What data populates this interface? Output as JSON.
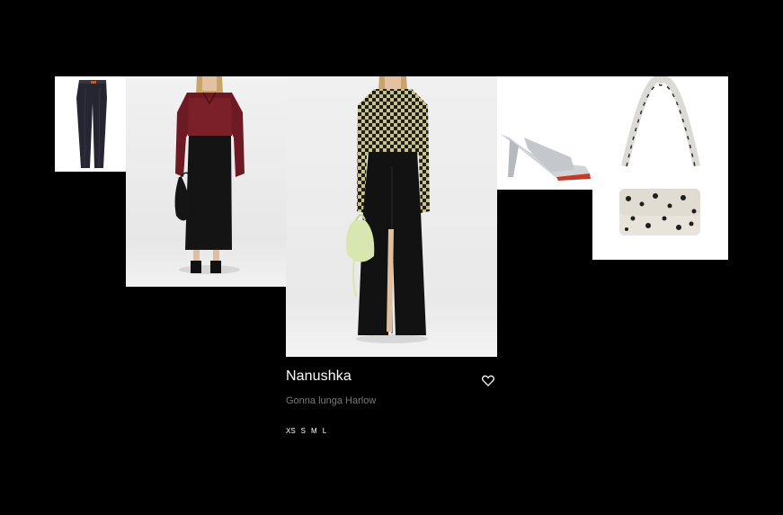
{
  "product": {
    "brand": "Nanushka",
    "name": "Gonna lunga Harlow",
    "sizes": [
      "XS",
      "S",
      "M",
      "L"
    ]
  },
  "icons": {
    "favorite": "heart-outline-icon"
  },
  "colors": {
    "background": "#000000",
    "brand_text": "#ffffff",
    "product_text": "#7a7a7a"
  }
}
